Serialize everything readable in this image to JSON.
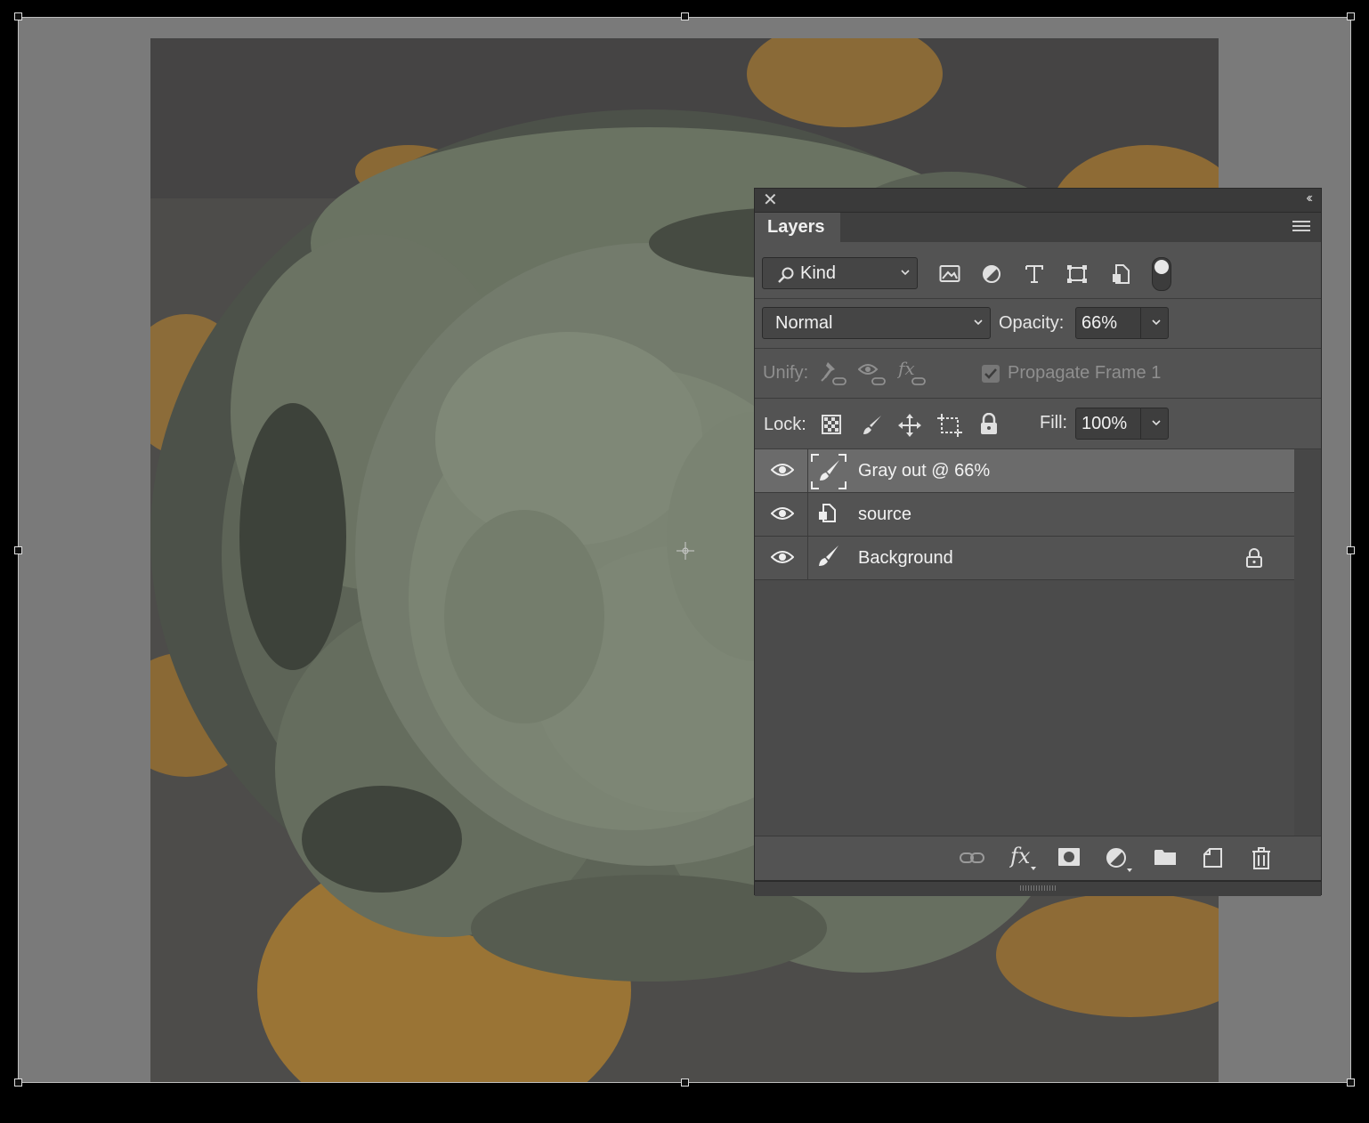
{
  "panel": {
    "title": "Layers",
    "filter": {
      "kind_label": "Kind"
    },
    "blend": {
      "mode": "Normal",
      "opacity_label": "Opacity:",
      "opacity_value": "66%"
    },
    "unify": {
      "label": "Unify:",
      "propagate_label": "Propagate Frame 1",
      "propagate_checked": true
    },
    "lock": {
      "label": "Lock:",
      "fill_label": "Fill:",
      "fill_value": "100%"
    },
    "layers": [
      {
        "name": "Gray out @ 66%",
        "visible": true,
        "selected": true,
        "type": "brush-mask",
        "locked": false
      },
      {
        "name": "source",
        "visible": true,
        "selected": false,
        "type": "smart-object",
        "locked": false
      },
      {
        "name": "Background",
        "visible": true,
        "selected": false,
        "type": "brush",
        "locked": true
      }
    ],
    "icons": {
      "filters": [
        "image-filter-icon",
        "adjustment-filter-icon",
        "type-filter-icon",
        "shape-filter-icon",
        "smart-object-filter-icon",
        "filter-toggle-icon"
      ],
      "lock": [
        "lock-transparent-pixels-icon",
        "lock-image-pixels-icon",
        "lock-position-icon",
        "lock-artboard-icon",
        "lock-all-icon"
      ],
      "bottom": [
        "link-layers-icon",
        "layer-style-icon",
        "add-mask-icon",
        "new-adjustment-icon",
        "new-group-icon",
        "new-layer-icon",
        "delete-layer-icon"
      ]
    }
  },
  "colors": {
    "canvas_gray": "#7a7a7a",
    "panel_bg": "#535353",
    "selected_row": "#6b6b6b"
  }
}
